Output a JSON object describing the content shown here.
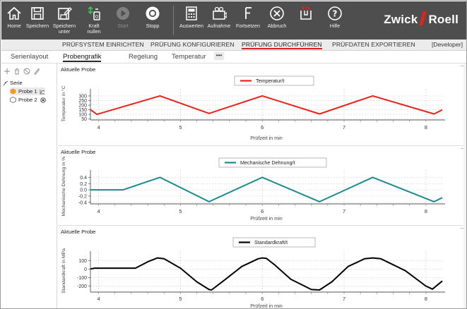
{
  "toolbar": {
    "home": "Home",
    "save": "Speichern",
    "save_as": "Speichern unter",
    "force_zero": "Kraft nullen",
    "start": "Start",
    "stop": "Stopp",
    "evaluate": "Auswerten",
    "record": "Aufnahme",
    "continue": "Fortsetzen",
    "abort": "Abbruch",
    "help": "Hilfe",
    "brand_left": "Zwick",
    "brand_right": "Roell"
  },
  "workflow": {
    "tabs": [
      "PRÜFSYSTEM EINRICHTEN",
      "PRÜFUNG KONFIGURIEREN",
      "PRÜFUNG DURCHFÜHREN",
      "PRÜFDATEN EXPORTIEREN"
    ],
    "active_index": 2,
    "user": "[Developer]"
  },
  "subtabs": {
    "tabs": [
      "Serienlayout",
      "Probengrafik",
      "Regelung",
      "Temperatur"
    ],
    "active_index": 1,
    "more": "•••"
  },
  "tree": {
    "root": "Serie",
    "items": [
      "Probe 1",
      "Probe 2"
    ]
  },
  "colors": {
    "toolbar_bg": "#4e4e4e",
    "accent_red": "#d61f26",
    "series_temp": "#e8221b",
    "series_strain": "#1b8a8c",
    "series_force": "#000000"
  },
  "chart_data": [
    {
      "type": "line",
      "panel_title": "Aktuelle Probe",
      "xlabel": "Prüfzeit in min",
      "ylabel": "Temperatur in °C",
      "xlim": [
        3.9,
        8.2
      ],
      "ylim": [
        40,
        330
      ],
      "xticks": [
        4,
        5,
        6,
        7,
        8
      ],
      "yticks": [
        50,
        100,
        150,
        200,
        250,
        300
      ],
      "legend": "top-center",
      "grid": true,
      "series": [
        {
          "name": "Temperatur/t",
          "color": "#e8221b",
          "x": [
            3.9,
            3.98,
            4.75,
            5.35,
            6.0,
            6.7,
            7.35,
            8.1,
            8.2
          ],
          "y": [
            150,
            100,
            300,
            110,
            300,
            105,
            300,
            105,
            150
          ]
        }
      ]
    },
    {
      "type": "line",
      "panel_title": "Aktuelle Probe",
      "xlabel": "Prüfzeit in min",
      "ylabel": "Mechanische Dehnung in %",
      "xlim": [
        3.9,
        8.2
      ],
      "ylim": [
        -0.45,
        0.5
      ],
      "xticks": [
        4,
        5,
        6,
        7,
        8
      ],
      "yticks": [
        -0.4,
        -0.2,
        0.0,
        0.2,
        0.4
      ],
      "legend": "top-center",
      "grid": true,
      "series": [
        {
          "name": "Mechanische Dehnung/t",
          "color": "#1b8a8c",
          "x": [
            3.9,
            4.3,
            4.75,
            5.35,
            6.0,
            6.7,
            7.35,
            8.1,
            8.2
          ],
          "y": [
            0.0,
            0.0,
            0.4,
            -0.38,
            0.4,
            -0.38,
            0.4,
            -0.38,
            -0.25
          ]
        }
      ]
    },
    {
      "type": "line",
      "panel_title": "Aktuelle Probe",
      "xlabel": "Prüfzeit in min",
      "ylabel": "Standardkraft in MPa",
      "xlim": [
        3.9,
        8.2
      ],
      "ylim": [
        -270,
        160
      ],
      "xticks": [
        4,
        5,
        6,
        7,
        8
      ],
      "yticks": [
        -200,
        -100,
        0,
        100
      ],
      "legend": "top-center",
      "grid": true,
      "series": [
        {
          "name": "Standardkraft/t",
          "color": "#000000",
          "x": [
            3.9,
            3.95,
            4.0,
            4.3,
            4.45,
            4.6,
            4.72,
            4.8,
            5.0,
            5.2,
            5.35,
            5.38,
            5.55,
            5.75,
            5.95,
            6.0,
            6.05,
            6.15,
            6.35,
            6.6,
            6.7,
            6.85,
            7.05,
            7.25,
            7.35,
            7.45,
            7.75,
            8.0,
            8.08,
            8.2
          ],
          "y": [
            0,
            10,
            10,
            10,
            10,
            85,
            130,
            120,
            10,
            -150,
            -240,
            -245,
            -120,
            30,
            120,
            130,
            125,
            50,
            -120,
            -240,
            -245,
            -150,
            30,
            120,
            130,
            120,
            -20,
            -200,
            -235,
            -140
          ]
        }
      ]
    }
  ]
}
